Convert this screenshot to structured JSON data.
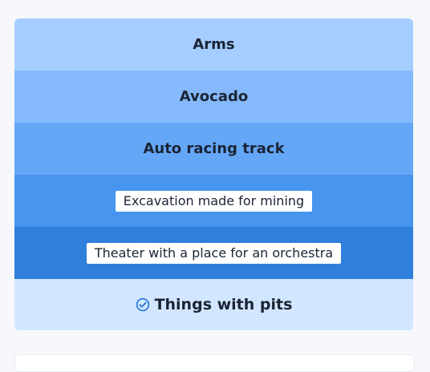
{
  "rows": [
    {
      "label": "Arms",
      "style": "plain",
      "bg": "#a6cdff"
    },
    {
      "label": "Avocado",
      "style": "plain",
      "bg": "#86b9fb"
    },
    {
      "label": "Auto racing track",
      "style": "plain",
      "bg": "#65a7f7"
    },
    {
      "label": "Excavation made for mining",
      "style": "pill",
      "bg": "#4795ef"
    },
    {
      "label": "Theater with a place for an orchestra",
      "style": "pill",
      "bg": "#2f7fdc"
    }
  ],
  "answer": {
    "label": "Things with pits",
    "bg": "#d2e7ff",
    "icon": "check-circle-icon",
    "icon_color": "#2f7fdc"
  }
}
